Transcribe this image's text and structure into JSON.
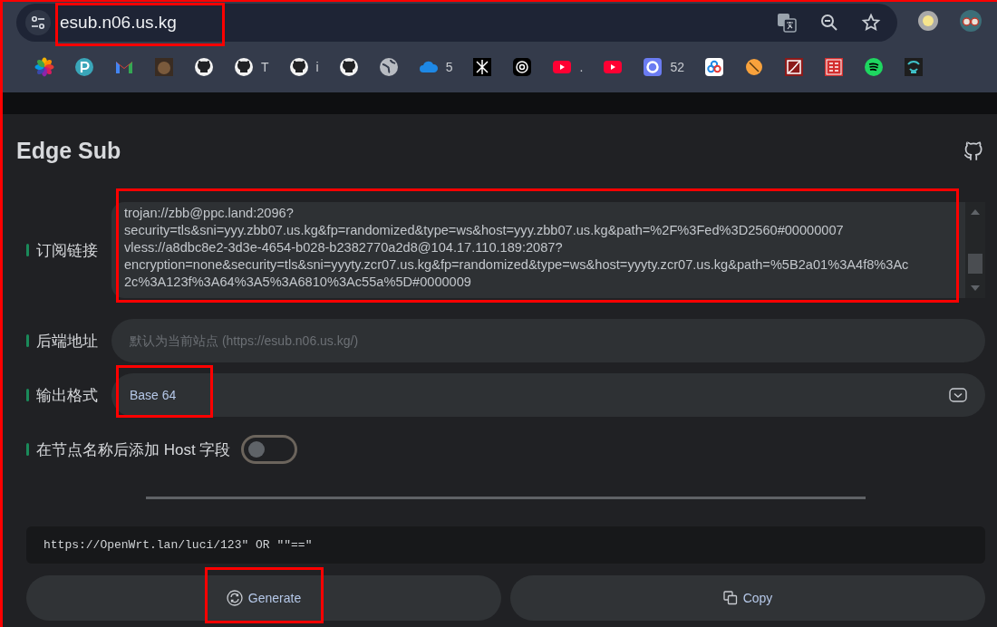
{
  "browser": {
    "address": "esub.n06.us.kg",
    "bookmarks": [
      {
        "kind": "pinwheel"
      },
      {
        "kind": "p-circle"
      },
      {
        "kind": "mail"
      },
      {
        "kind": "photo"
      },
      {
        "kind": "github"
      },
      {
        "kind": "github",
        "label": "T"
      },
      {
        "kind": "github",
        "label": "i"
      },
      {
        "kind": "github"
      },
      {
        "kind": "globe"
      },
      {
        "kind": "cloud",
        "label": "5"
      },
      {
        "kind": "glyph"
      },
      {
        "kind": "knot"
      },
      {
        "kind": "play",
        "label": "."
      },
      {
        "kind": "play"
      },
      {
        "kind": "ring",
        "label": "52"
      },
      {
        "kind": "petals"
      },
      {
        "kind": "slash-circle"
      },
      {
        "kind": "square-mark"
      },
      {
        "kind": "seal"
      },
      {
        "kind": "spotify"
      },
      {
        "kind": "bird"
      }
    ]
  },
  "app": {
    "title": "Edge Sub",
    "subscription": {
      "label": "订阅链接",
      "lines": [
        "trojan://zbb@ppc.land:2096?",
        "security=tls&sni=yyy.zbb07.us.kg&fp=randomized&type=ws&host=yyy.zbb07.us.kg&path=%2F%3Fed%3D2560#00000007",
        "vless://a8dbc8e2-3d3e-4654-b028-b2382770a2d8@104.17.110.189:2087?",
        "encryption=none&security=tls&sni=yyyty.zcr07.us.kg&fp=randomized&type=ws&host=yyyty.zcr07.us.kg&path=%5B2a01%3A4f8%3Ac",
        "2c%3A123f%3A64%3A5%3A6810%3Ac55a%5D#0000009"
      ]
    },
    "backend": {
      "label": "后端地址",
      "placeholder": "默认为当前站点 (https://esub.n06.us.kg/)"
    },
    "format": {
      "label": "输出格式",
      "value": "Base 64"
    },
    "host_toggle": {
      "label": "在节点名称后添加 Host 字段",
      "on": false
    },
    "output": "https://OpenWrt.lan/luci/123″ OR ″″==″",
    "buttons": [
      {
        "kind": "generate",
        "label": "Generate"
      },
      {
        "kind": "copy",
        "label": "Copy"
      }
    ]
  }
}
